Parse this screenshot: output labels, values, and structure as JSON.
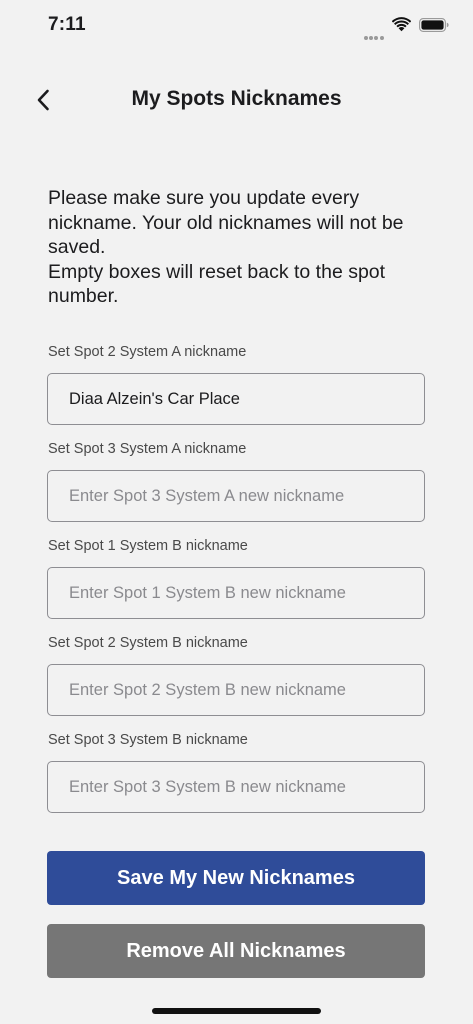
{
  "status_bar": {
    "time": "7:11"
  },
  "nav": {
    "title": "My Spots Nicknames"
  },
  "intro": {
    "line1": "Please make sure you update every nickname. Your old nicknames will not be saved.",
    "line2": "Empty boxes will reset back to the spot number."
  },
  "fields": [
    {
      "label": "Set Spot 2 System A nickname",
      "value": "Diaa Alzein's Car Place",
      "placeholder": ""
    },
    {
      "label": "Set Spot 3 System A nickname",
      "value": "",
      "placeholder": "Enter Spot 3 System A new nickname"
    },
    {
      "label": "Set Spot 1 System B nickname",
      "value": "",
      "placeholder": "Enter Spot 1 System B new nickname"
    },
    {
      "label": "Set Spot 2 System B nickname",
      "value": "",
      "placeholder": "Enter Spot 2 System B new nickname"
    },
    {
      "label": "Set Spot 3 System B nickname",
      "value": "",
      "placeholder": "Enter Spot 3 System B new nickname"
    }
  ],
  "buttons": {
    "save_label": "Save My New Nicknames",
    "remove_label": "Remove All Nicknames"
  },
  "colors": {
    "save_button": "#2f4c99",
    "remove_button": "#767676",
    "background": "#f2f2f2"
  },
  "icons": {
    "back": "chevron-left-icon",
    "wifi": "wifi-icon",
    "battery": "battery-icon",
    "signal": "signal-dots-icon"
  }
}
